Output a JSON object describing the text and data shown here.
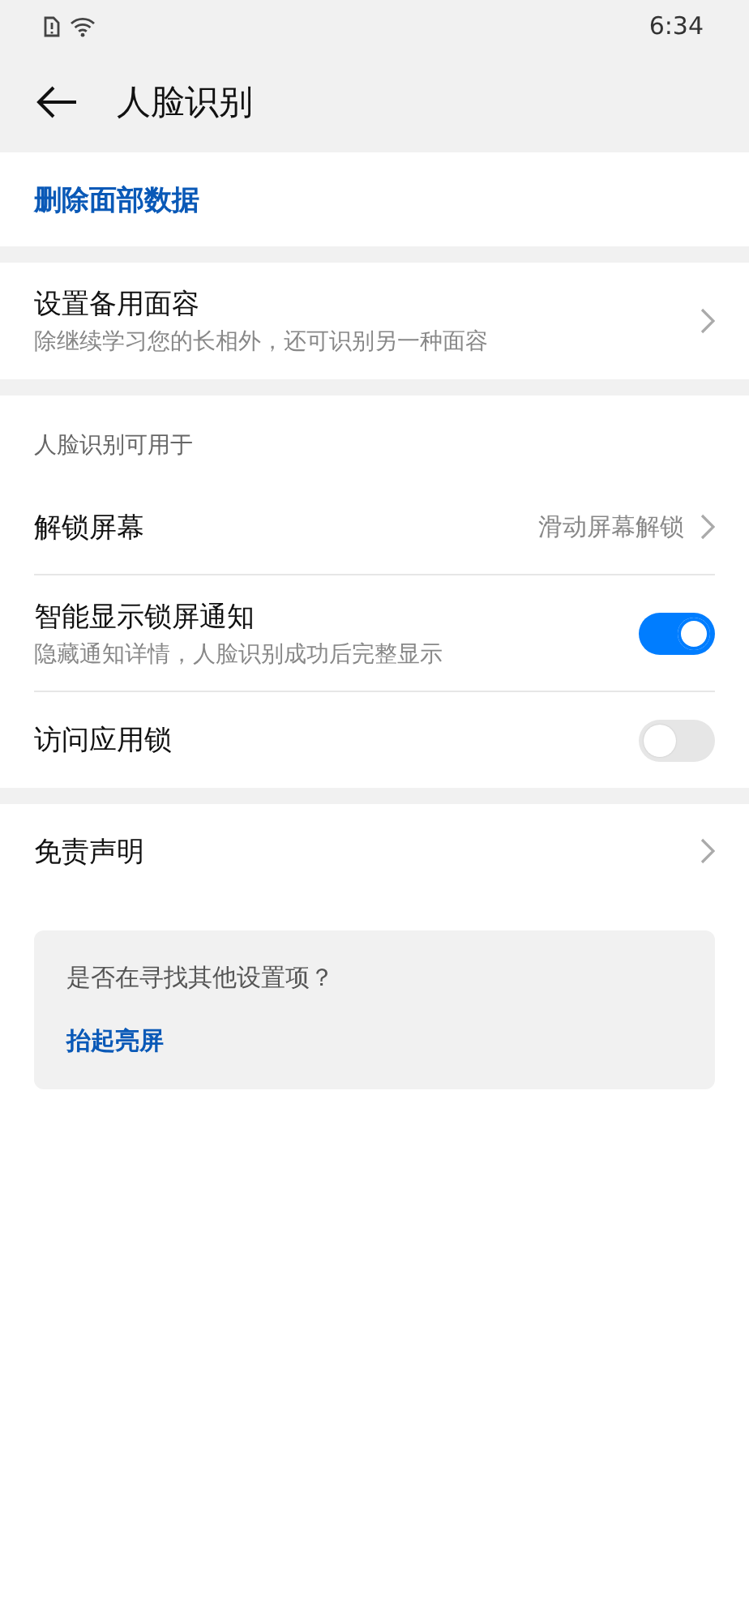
{
  "status_bar": {
    "time": "6:34"
  },
  "header": {
    "title": "人脸识别"
  },
  "sections": [
    {
      "items": [
        {
          "kind": "action",
          "label": "删除面部数据"
        }
      ]
    },
    {
      "items": [
        {
          "kind": "nav",
          "label": "设置备用面容",
          "subtitle": "除继续学习您的长相外，还可识别另一种面容"
        }
      ]
    },
    {
      "caption": "人脸识别可用于",
      "items": [
        {
          "kind": "nav",
          "label": "解锁屏幕",
          "value": "滑动屏幕解锁"
        },
        {
          "kind": "switch",
          "label": "智能显示锁屏通知",
          "subtitle": "隐藏通知详情，人脸识别成功后完整显示",
          "on": true
        },
        {
          "kind": "switch",
          "label": "访问应用锁",
          "on": false
        }
      ]
    },
    {
      "items": [
        {
          "kind": "nav",
          "label": "免责声明"
        }
      ]
    }
  ],
  "suggestion": {
    "question": "是否在寻找其他设置项？",
    "link": "抬起亮屏"
  }
}
